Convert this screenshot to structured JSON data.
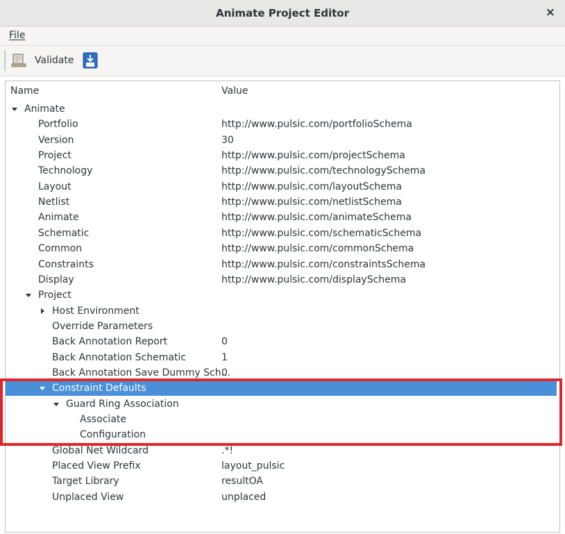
{
  "window": {
    "title": "Animate Project Editor",
    "close_glyph": "×"
  },
  "menu": {
    "file_label": "File"
  },
  "toolbar": {
    "validate_label": "Validate",
    "validate_icon": "validate-document-icon",
    "download_icon": "save-download-icon"
  },
  "columns": {
    "name": "Name",
    "value": "Value"
  },
  "rows": [
    {
      "name": "Animate",
      "value": "",
      "expander": "expanded"
    },
    {
      "name": "Portfolio",
      "value": "http://www.pulsic.com/portfolioSchema"
    },
    {
      "name": "Version",
      "value": "30"
    },
    {
      "name": "Project",
      "value": "http://www.pulsic.com/projectSchema"
    },
    {
      "name": "Technology",
      "value": "http://www.pulsic.com/technologySchema"
    },
    {
      "name": "Layout",
      "value": "http://www.pulsic.com/layoutSchema"
    },
    {
      "name": "Netlist",
      "value": "http://www.pulsic.com/netlistSchema"
    },
    {
      "name": "Animate",
      "value": "http://www.pulsic.com/animateSchema"
    },
    {
      "name": "Schematic",
      "value": "http://www.pulsic.com/schematicSchema"
    },
    {
      "name": "Common",
      "value": "http://www.pulsic.com/commonSchema"
    },
    {
      "name": "Constraints",
      "value": "http://www.pulsic.com/constraintsSchema"
    },
    {
      "name": "Display",
      "value": "http://www.pulsic.com/displaySchema"
    },
    {
      "name": "Project",
      "value": "",
      "expander": "expanded"
    },
    {
      "name": "Host Environment",
      "value": "",
      "expander": "collapsed"
    },
    {
      "name": "Override Parameters",
      "value": ""
    },
    {
      "name": "Back Annotation Report",
      "value": "0"
    },
    {
      "name": "Back Annotation Schematic",
      "value": "1"
    },
    {
      "name": "Back Annotation Save Dummy Sch...",
      "value": "0"
    },
    {
      "name": "Constraint Defaults",
      "value": "",
      "expander": "expanded",
      "selected": true
    },
    {
      "name": "Guard Ring Association",
      "value": "",
      "expander": "expanded"
    },
    {
      "name": "Associate",
      "value": ""
    },
    {
      "name": "Configuration",
      "value": ""
    },
    {
      "name": "Global Net Wildcard",
      "value": ".*!"
    },
    {
      "name": "Placed View Prefix",
      "value": "layout_pulsic"
    },
    {
      "name": "Target Library",
      "value": "resultOA"
    },
    {
      "name": "Unplaced View",
      "value": "unplaced"
    }
  ],
  "colors": {
    "selection": "#4a90d9",
    "highlight_box": "#e0262b"
  }
}
